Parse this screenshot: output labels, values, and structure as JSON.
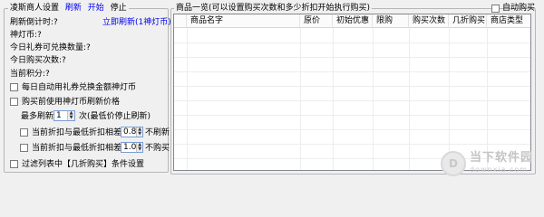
{
  "left": {
    "group_title": "凌斯商人设置",
    "tab_refresh": "刷新",
    "tab_start": "开始",
    "tab_stop": "停止",
    "countdown_label": "刷新倒计时:",
    "countdown_value": "?",
    "refresh_now_link": "立即刷新(1神灯币)",
    "coins_label": "神灯币:",
    "coins_value": "?",
    "exchange_label": "今日礼券可兑换数量:",
    "exchange_value": "?",
    "buy_count_label": "今日购买次数:",
    "buy_count_value": "?",
    "points_label": "当前积分:",
    "points_value": "?",
    "auto_exchange_label": "每日自动用礼券兑换金额神灯币",
    "use_coins_label": "购买前使用神灯币刷新价格",
    "max_refresh_prefix": "最多刷新",
    "max_refresh_value": "1",
    "max_refresh_suffix": "次(最低价停止刷新)",
    "discount1_label": "当前折扣与最低折扣相差",
    "discount1_value": "0.8",
    "discount1_suffix": "不刷新",
    "discount2_label": "当前折扣与最低折扣相差",
    "discount2_value": "1.0",
    "discount2_suffix": "不购买",
    "filter_label": "过滤列表中【几折购买】条件设置"
  },
  "right": {
    "group_title": "商品一览(可以设置购买次数和多少折扣开始执行购买)",
    "auto_buy_label": "自动购买",
    "columns": [
      "商品名字",
      "原价",
      "初始优惠",
      "限购",
      "购买次数",
      "几折购买",
      "商店类型"
    ]
  },
  "watermark": {
    "cn": "当下软件园",
    "en": "downxia.com"
  }
}
